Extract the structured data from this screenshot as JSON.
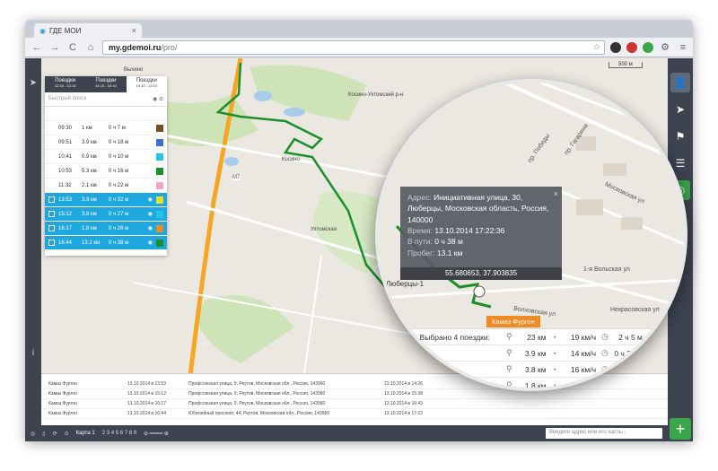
{
  "browser": {
    "tab_title": "ГДЕ МОИ",
    "tab_close": "×",
    "url_host": "my.gdemoi.ru",
    "url_path": "/pro/",
    "nav": {
      "back": "←",
      "forward": "→",
      "reload": "C",
      "home": "⌂"
    }
  },
  "map": {
    "scale_label": "500 м",
    "place_labels": [
      "Косино",
      "Люберцы-1",
      "Кузьминки",
      "Жулебино",
      "Чернов",
      "Выхино",
      "Косино-Ухтомский р-н",
      "Некрасовская ул",
      "Волховская ул",
      "1-я Вольская ул",
      "Московская ул",
      "пр. Победы",
      "пр. Гагарина",
      "Октябрьский пр",
      "Ухтомская",
      "Перовская ул",
      "М7"
    ]
  },
  "panel": {
    "tabs": [
      {
        "label": "Поездки",
        "sub": "12.10 - 13.10"
      },
      {
        "label": "Поездки",
        "sub": "14.10 - 15.10"
      },
      {
        "label": "Поездки",
        "sub": "13.10 - 13.10"
      }
    ],
    "search_placeholder": "Быстрый поиск",
    "trips": [
      {
        "time": "",
        "dist": "",
        "dur": "",
        "color": "#ffffff",
        "selected": false
      },
      {
        "time": "09:30",
        "dist": "1 км",
        "dur": "0 ч 7 м",
        "color": "#7a4e24",
        "selected": false
      },
      {
        "time": "09:51",
        "dist": "3.9 км",
        "dur": "0 ч 18 м",
        "color": "#3c6fd8",
        "selected": false
      },
      {
        "time": "10:41",
        "dist": "0.9 км",
        "dur": "0 ч 10 м",
        "color": "#1ec7e6",
        "selected": false
      },
      {
        "time": "10:53",
        "dist": "5.3 км",
        "dur": "0 ч 16 м",
        "color": "#1b8f2a",
        "selected": false
      },
      {
        "time": "11:32",
        "dist": "2.1 км",
        "dur": "0 ч 22 м",
        "color": "#f2a3c6",
        "selected": false
      },
      {
        "time": "13:53",
        "dist": "3.9 км",
        "dur": "0 ч 32 м",
        "color": "#e6e22a",
        "selected": true
      },
      {
        "time": "15:12",
        "dist": "3.8 км",
        "dur": "0 ч 27 м",
        "color": "#1ec7e6",
        "selected": true
      },
      {
        "time": "16:17",
        "dist": "1.8 км",
        "dur": "0 ч 26 м",
        "color": "#f08a24",
        "selected": true
      },
      {
        "time": "16:44",
        "dist": "13.1 км",
        "dur": "0 ч 38 м",
        "color": "#1b8f2a",
        "selected": true
      }
    ]
  },
  "infobox": {
    "addr_label": "Адрес:",
    "address": "Инициативная улица, 30, Люберцы, Московская область, Россия, 140000",
    "time_label": "Время:",
    "time": "13.10.2014 17:22:36",
    "ontheway_label": "В пути:",
    "ontheway": "0 ч 38 м",
    "mileage_label": "Пробег:",
    "mileage": "13.1 км",
    "coords": "55.680653, 37.903835",
    "close": "×"
  },
  "car_label": "Камаз Фургон",
  "summary": {
    "title": "Выбрано 4 поездки:",
    "total": {
      "dist": "23 км",
      "speed": "19 км/ч",
      "dur": "2 ч 5 м"
    },
    "rows": [
      {
        "left": "143960",
        "dist": "3.9 км",
        "speed": "14 км/ч",
        "dur": "0 ч 32 м"
      },
      {
        "left": "",
        "dist": "3.8 км",
        "speed": "16 км/ч",
        "dur": "0 ч 27 м"
      },
      {
        "left": "143960",
        "dist": "1.8 км",
        "speed": "4 км/ч",
        "dur": "0 ч 26 м"
      },
      {
        "left": "",
        "dist": "13.1 км",
        "speed": "36 км/ч",
        "dur": "0 ч 38 м"
      }
    ]
  },
  "bottom_rows": [
    {
      "car": "Камаз Фургон",
      "start": "13.10.2014 в 13:53",
      "addr": "Профсоюзная улица, 9, Реутов, Московская обл., Россия, 143960",
      "end": "13.10.2014 в 14:26"
    },
    {
      "car": "Камаз Фургон",
      "start": "13.10.2014 в 15:12",
      "addr": "Профсоюзная улица, 9, Реутов, Московская обл., Россия, 143960",
      "end": "13.10.2014 в 15:38"
    },
    {
      "car": "Камаз Фургон",
      "start": "13.10.2014 в 16:17",
      "addr": "Профсоюзная улица, 9, Реутов, Московская обл., Россия, 143960",
      "end": "13.10.2014 в 16:43"
    },
    {
      "car": "Камаз Фургон",
      "start": "13.10.2014 в 16:44",
      "addr": "Юбилейный проспект, 44, Реутов, Московская обл., Россия, 143960",
      "end": "13.10.2014 в 17:22"
    }
  ],
  "footer": {
    "map_label": "Карта 1",
    "pages": "2 3 4 5 6 7 8 9",
    "search_placeholder": "Введите адрес или его часть..."
  }
}
